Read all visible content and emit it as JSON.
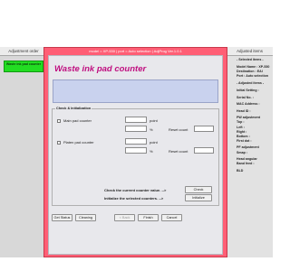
{
  "left_panel": {
    "header": "Adjustment order",
    "items": [
      "Waste ink pad counter"
    ]
  },
  "right_panel": {
    "header": "Adjusted items",
    "lines": [
      {
        "text": "- Selected items -",
        "cls": "sec"
      },
      {
        "text": "",
        "cls": "gap"
      },
      {
        "text": "Model Name : XP-530",
        "cls": ""
      },
      {
        "text": "Destination : EAI",
        "cls": ""
      },
      {
        "text": "Port : Auto selection",
        "cls": ""
      },
      {
        "text": "",
        "cls": "gap"
      },
      {
        "text": "- Adjusted items -",
        "cls": "sec"
      },
      {
        "text": "",
        "cls": "gap"
      },
      {
        "text": "Initial Setting :",
        "cls": ""
      },
      {
        "text": "",
        "cls": "gap"
      },
      {
        "text": "Serial No. :",
        "cls": ""
      },
      {
        "text": "",
        "cls": "gap"
      },
      {
        "text": "MAC Address :",
        "cls": ""
      },
      {
        "text": "",
        "cls": "gap"
      },
      {
        "text": "Head ID :",
        "cls": ""
      },
      {
        "text": "",
        "cls": "gap"
      },
      {
        "text": "PW adjustment",
        "cls": ""
      },
      {
        "text": "Top :",
        "cls": ""
      },
      {
        "text": "Left :",
        "cls": ""
      },
      {
        "text": "Right :",
        "cls": ""
      },
      {
        "text": "Bottom :",
        "cls": ""
      },
      {
        "text": "First dot :",
        "cls": ""
      },
      {
        "text": "",
        "cls": "gap"
      },
      {
        "text": "PF adjustment",
        "cls": ""
      },
      {
        "text": "Smap :",
        "cls": ""
      },
      {
        "text": "",
        "cls": "gap"
      },
      {
        "text": "Head angular",
        "cls": ""
      },
      {
        "text": "Band feed :",
        "cls": ""
      },
      {
        "text": "",
        "cls": "gap"
      },
      {
        "text": "BLD",
        "cls": ""
      }
    ]
  },
  "dialog": {
    "title": "model = XP-530 | port = Auto selection | AdjProg Ver.1.0.1",
    "heading": "Waste ink pad counter",
    "group_title": "Check & Initialization",
    "main_pad": {
      "label": "Main pad counter",
      "unit_top": "point",
      "unit_bottom": "%",
      "reset_label": "Reset count"
    },
    "platen_pad": {
      "label": "Platen pad counter",
      "unit_top": "point",
      "unit_bottom": "%",
      "reset_label": "Reset count"
    },
    "check_text": "Check the current counter value. -->",
    "init_text": "Initialize the selected counters. -->",
    "check_button": "Check",
    "initialize_button": "Initialize",
    "bottom_buttons": {
      "get_status": "Get Status",
      "cleaning": "Cleaning",
      "back": "< Back",
      "finish": "Finish",
      "cancel": "Cancel"
    }
  },
  "colors": {
    "dialog_frame": "#ff5e75",
    "heading": "#c01080",
    "left_item_bg": "#22dd22"
  }
}
